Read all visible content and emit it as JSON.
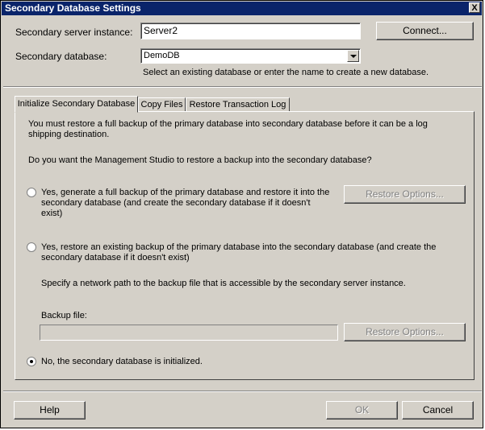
{
  "window": {
    "title": "Secondary Database Settings",
    "close_label": "X"
  },
  "form": {
    "server_label_pre": "Secondary server instance:",
    "server_value": "Server2",
    "connect_label": "Connect...",
    "db_label": "Secondary database:",
    "db_value": "DemoDB",
    "db_hint": "Select an existing database or enter the name to create a new database."
  },
  "tabs": [
    {
      "label": "Initialize Secondary Database",
      "active": true
    },
    {
      "label": "Copy Files",
      "active": false
    },
    {
      "label": "Restore Transaction Log",
      "active": false
    }
  ],
  "panel": {
    "intro": "You must restore a full backup of the primary database into secondary database before it can be a log shipping destination.",
    "question": "Do you want the Management Studio to restore a backup into the secondary database?",
    "option1": "Yes, generate a full backup of the primary database and restore it into the secondary database (and create the secondary database if it doesn't exist)",
    "option1_button": "Restore Options...",
    "option2": "Yes, restore an existing backup of the primary database into the secondary database (and create the secondary database if it doesn't exist)",
    "option2_note": "Specify a network path to the backup file that is accessible by the secondary server instance.",
    "backup_label": "Backup file:",
    "backup_value": "",
    "option2_button": "Restore Options...",
    "option3": "No, the secondary database is initialized."
  },
  "footer": {
    "help_label": "Help",
    "ok_label": "OK",
    "cancel_label": "Cancel"
  }
}
